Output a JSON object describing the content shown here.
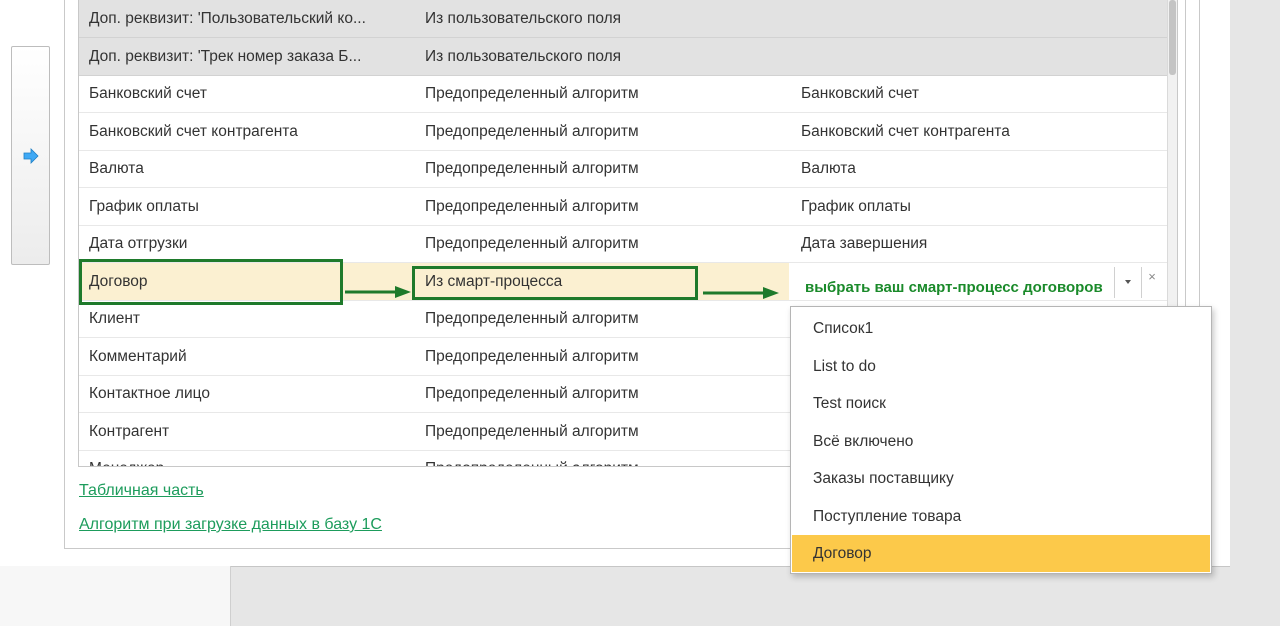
{
  "table": {
    "rows": [
      {
        "field": "Доп. реквизит: 'Пользовательский ко...",
        "source": "Из пользовательского поля",
        "value": "",
        "state": "grey"
      },
      {
        "field": "Доп. реквизит: 'Трек номер заказа Б...",
        "source": "Из пользовательского поля",
        "value": "",
        "state": "grey"
      },
      {
        "field": "Банковский счет",
        "source": "Предопределенный алгоритм",
        "value": "Банковский счет",
        "state": "normal"
      },
      {
        "field": "Банковский счет контрагента",
        "source": "Предопределенный алгоритм",
        "value": "Банковский счет контрагента",
        "state": "normal"
      },
      {
        "field": "Валюта",
        "source": "Предопределенный алгоритм",
        "value": "Валюта",
        "state": "normal"
      },
      {
        "field": "График оплаты",
        "source": "Предопределенный алгоритм",
        "value": "График оплаты",
        "state": "normal"
      },
      {
        "field": "Дата отгрузки",
        "source": "Предопределенный алгоритм",
        "value": "Дата завершения",
        "state": "normal"
      },
      {
        "field": "Договор",
        "source": "Из смарт-процесса",
        "value": "",
        "state": "selected"
      },
      {
        "field": "Клиент",
        "source": "Предопределенный алгоритм",
        "value": "",
        "state": "normal"
      },
      {
        "field": "Комментарий",
        "source": "Предопределенный алгоритм",
        "value": "",
        "state": "normal"
      },
      {
        "field": "Контактное лицо",
        "source": "Предопределенный алгоритм",
        "value": "",
        "state": "normal"
      },
      {
        "field": "Контрагент",
        "source": "Предопределенный алгоритм",
        "value": "",
        "state": "normal"
      },
      {
        "field": "Менеджер",
        "source": "Предопределенный алгоритм",
        "value": "",
        "state": "normal"
      }
    ]
  },
  "edit_hint": "выбрать ваш смарт-процесс договоров",
  "clear_glyph": "×",
  "dropdown": {
    "items": [
      "Список1",
      "List to do",
      "Test поиск",
      "Всё включено",
      "Заказы поставщику",
      "Поступление товара",
      "Договор"
    ],
    "active_index": 6
  },
  "links": {
    "tabular_part": "Табличная часть",
    "algorithm": "Алгоритм при загрузке данных в базу 1С"
  },
  "colors": {
    "annotation_green": "#1e7a2b",
    "hint_green": "#1a8a2a",
    "link_green": "#1d9c5c",
    "dropdown_active": "#fcc94a",
    "selected_row": "#fbf0d1",
    "arrow_blue": "#3fa9f5"
  },
  "icons": {
    "side_button": "arrow-right-icon",
    "edit_dropdown": "triangle-down-icon",
    "edit_clear": "clear-icon"
  }
}
